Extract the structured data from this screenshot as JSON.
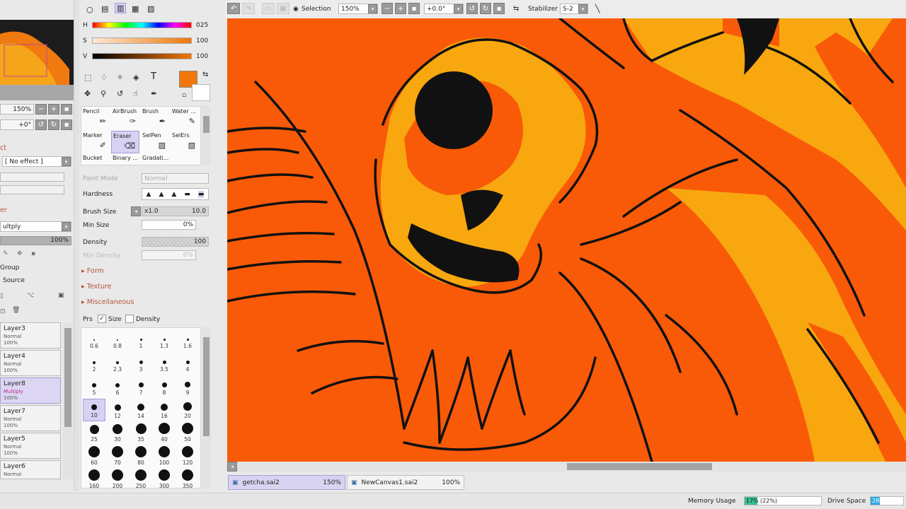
{
  "navigator": {
    "zoom": "150%",
    "angle": "+0°"
  },
  "color": {
    "h_label": "H",
    "h_value": "025",
    "s_label": "S",
    "s_value": "100",
    "v_label": "V",
    "v_value": "100",
    "main_color": "#f07708",
    "sub_color": "#ffffff"
  },
  "left_panel": {
    "effect_section": "ct",
    "effect_value": "[ No effect ]",
    "mode_section": "er",
    "blend_mode": "ultply",
    "opacity": "100%",
    "group_label": "Group",
    "source_label": "Source"
  },
  "layers": [
    {
      "name": "Layer3",
      "mode": "Normal",
      "opacity": "100%",
      "selected": false
    },
    {
      "name": "Layer4",
      "mode": "Normal",
      "opacity": "100%",
      "selected": false
    },
    {
      "name": "Layer8",
      "mode": "Multiply",
      "opacity": "100%",
      "selected": true
    },
    {
      "name": "Layer7",
      "mode": "Normal",
      "opacity": "100%",
      "selected": false
    },
    {
      "name": "Layer5",
      "mode": "Normal",
      "opacity": "100%",
      "selected": false
    },
    {
      "name": "Layer6",
      "mode": "Normal",
      "opacity": "",
      "selected": false
    }
  ],
  "tools": {
    "row1": [
      "Pencil",
      "AirBrush",
      "Brush",
      "Water ..."
    ],
    "row2": [
      "Marker",
      "Eraser",
      "SelPen",
      "SelErs"
    ],
    "row3": [
      "Bucket",
      "Binary ...",
      "Gradati..."
    ],
    "selected": "Eraser",
    "text_tool": "T"
  },
  "brush_settings": {
    "paint_mode_label": "Paint Mode",
    "paint_mode_value": "Normal",
    "hardness_label": "Hardness",
    "brush_size_label": "Brush Size",
    "brush_size_mult": "x1.0",
    "brush_size_value": "10.0",
    "min_size_label": "Min Size",
    "min_size_value": "0%",
    "density_label": "Density",
    "density_value": "100",
    "min_density_label": "Min Density",
    "min_density_value": "0%",
    "form_label": "Form",
    "texture_label": "Texture",
    "misc_label": "Miscellaneous",
    "prs_label": "Prs",
    "size_label": "Size",
    "density_chk_label": "Density"
  },
  "brush_sizes": [
    "0.6",
    "0.8",
    "1",
    "1.3",
    "1.6",
    "2",
    "2.3",
    "3",
    "3.5",
    "4",
    "5",
    "6",
    "7",
    "8",
    "9",
    "10",
    "12",
    "14",
    "16",
    "20",
    "25",
    "30",
    "35",
    "40",
    "50",
    "60",
    "70",
    "80",
    "100",
    "120",
    "160",
    "200",
    "250",
    "300",
    "350"
  ],
  "toolbar": {
    "selection_label": "Selection",
    "zoom_value": "150%",
    "angle_value": "+0.0°",
    "stabilizer_label": "Stabilizer",
    "stabilizer_value": "S-2"
  },
  "tabs": [
    {
      "name": "getcha.sai2",
      "zoom": "150%",
      "active": true
    },
    {
      "name": "NewCanvas1.sai2",
      "zoom": "100%",
      "active": false
    }
  ],
  "status": {
    "memory_label": "Memory Usage",
    "memory_value": "17%",
    "memory_paren": "(22%)",
    "memory_fraction": 0.17,
    "drive_label": "Drive Space",
    "drive_value": "28%",
    "drive_fraction": 0.28
  }
}
